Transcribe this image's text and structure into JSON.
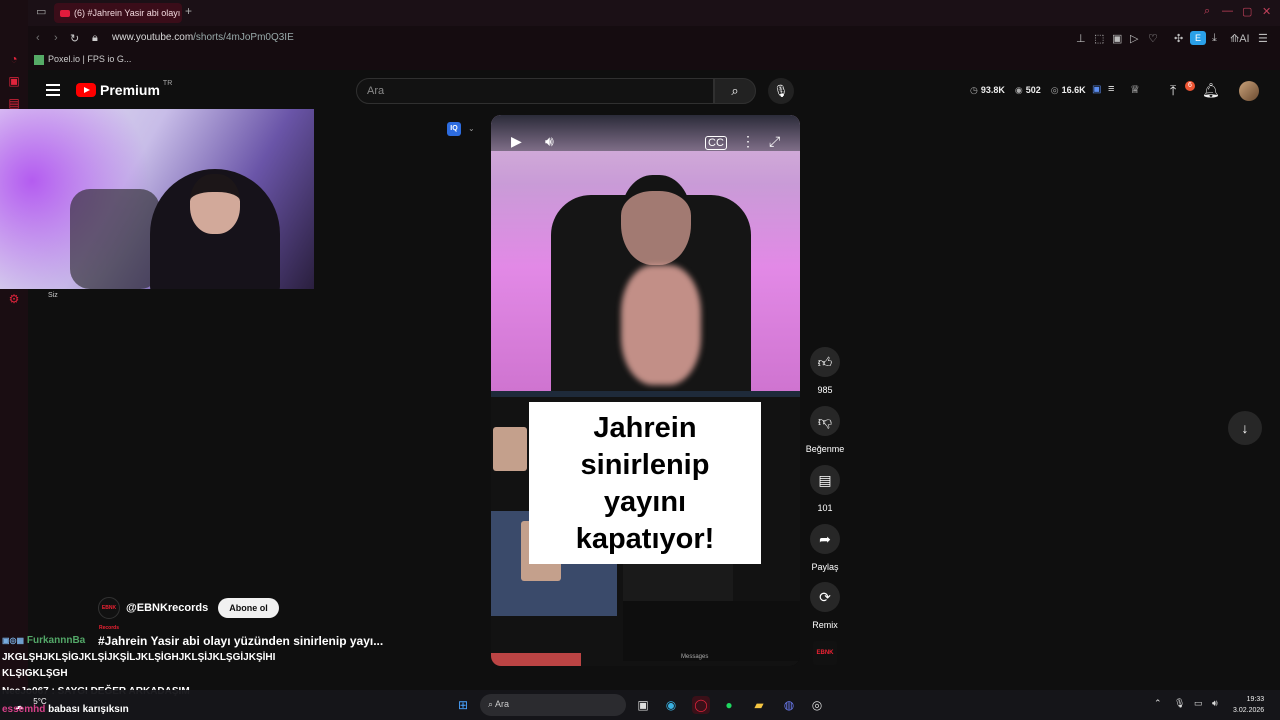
{
  "browser": {
    "tab_title": "(6) #Jahrein Yasir abi olayı",
    "url_host": "www.youtube.com",
    "url_path": "/shorts/4mJoPm0Q3IE",
    "bookmark": "Poxel.io | FPS io G...",
    "ext_e": "E",
    "ai_label": "AI"
  },
  "youtube": {
    "logo_text": "Premium",
    "region": "TR",
    "search_placeholder": "Ara",
    "stats": [
      {
        "icon": "clock-icon",
        "glyph": "◷",
        "value": "93.8K"
      },
      {
        "icon": "eye-icon",
        "glyph": "◉",
        "value": "502"
      },
      {
        "icon": "view-icon",
        "glyph": "◎",
        "value": "16.6K"
      }
    ],
    "notif_count": "6"
  },
  "webcam": {
    "label": "Siz"
  },
  "short": {
    "iq_badge": "IQ",
    "caption_lines": [
      "Jahrein",
      "sinirlenip",
      "yayını",
      "kapatıyor!"
    ],
    "messages_label": "Messages",
    "like_count": "985",
    "dislike_label": "Beğenme",
    "comment_count": "101",
    "share_label": "Paylaş",
    "remix_label": "Remix",
    "channel_thumb": "EBNK",
    "channel": "@EBNKrecords",
    "channel_avatar": "EBNK Records",
    "subscribe": "Abone ol",
    "title": "#Jahrein Yasir abi olayı yüzünden sinirlenip yayı..."
  },
  "chat": [
    {
      "user": "FurkannnBa",
      "text": ""
    },
    {
      "user": "",
      "text": "JKGLŞHJKLŞİGJKLŞİJKŞİLJKLŞİGHJKLŞİJKLŞGİJKŞİHI"
    },
    {
      "user": "",
      "text": "KLŞIGKLŞGH"
    },
    {
      "user": "NeeJo067",
      "text": ": SAYGI DEĞER ARKADAŞIM"
    },
    {
      "user": "essemhd",
      "text": "babası karışıksın"
    }
  ],
  "taskbar": {
    "search_placeholder": "Ara",
    "time": "19:33",
    "date": "3.02.2026",
    "weather": "5°C"
  }
}
